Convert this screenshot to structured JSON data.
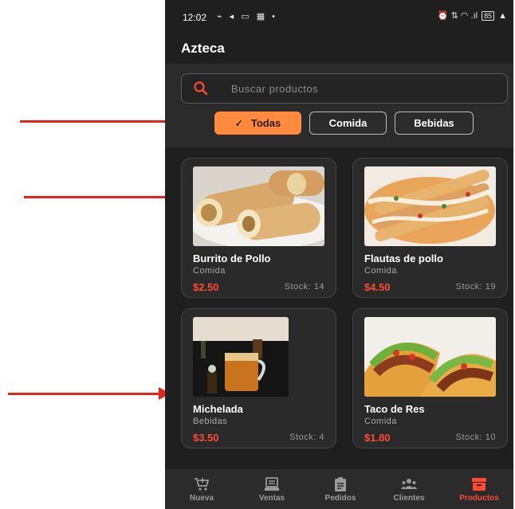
{
  "status_bar": {
    "time": "12:02",
    "left_icons": "⌁ ◂ ▭ ▦ •",
    "right_icons": "⏰ ⇅ ◠ .ıl",
    "battery": "85"
  },
  "app": {
    "title": "Azteca"
  },
  "search": {
    "placeholder": "Buscar productos"
  },
  "filters": [
    {
      "label": "Todas",
      "selected": true
    },
    {
      "label": "Comida",
      "selected": false
    },
    {
      "label": "Bebidas",
      "selected": false
    }
  ],
  "products": [
    {
      "name": "Burrito de Pollo",
      "category": "Comida",
      "price": "$2.50",
      "stock": "Stock: 14"
    },
    {
      "name": "Flautas de pollo",
      "category": "Comida",
      "price": "$4.50",
      "stock": "Stock: 19"
    },
    {
      "name": "Michelada",
      "category": "Bebidas",
      "price": "$3.50",
      "stock": "Stock: 4"
    },
    {
      "name": "Taco de Res",
      "category": "Comida",
      "price": "$1.80",
      "stock": "Stock: 10"
    }
  ],
  "nav": [
    {
      "label": "Nueva",
      "icon": "cart-add-icon"
    },
    {
      "label": "Ventas",
      "icon": "register-icon"
    },
    {
      "label": "Pedidos",
      "icon": "clipboard-icon"
    },
    {
      "label": "Clientes",
      "icon": "people-icon"
    },
    {
      "label": "Productos",
      "icon": "archive-icon",
      "active": true
    }
  ],
  "colors": {
    "accent": "#ff8a3d",
    "price": "#ff4a32",
    "background": "#1f1f1f",
    "annotation_arrow": "#e8221c"
  }
}
